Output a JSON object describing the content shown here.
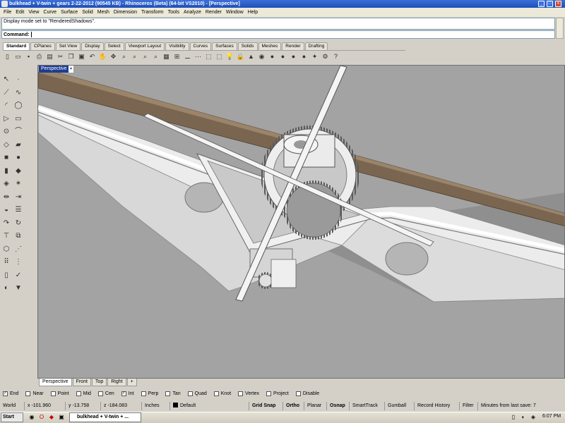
{
  "window": {
    "title": "bulkhead + V-twin + gears 2-22-2012 (90545 KB) - Rhinoceros (Beta) (64-bit VS2010) - [Perspective]",
    "min_label": "_",
    "max_label": "□",
    "close_label": "x"
  },
  "menu": [
    "File",
    "Edit",
    "View",
    "Curve",
    "Surface",
    "Solid",
    "Mesh",
    "Dimension",
    "Transform",
    "Tools",
    "Analyze",
    "Render",
    "Window",
    "Help"
  ],
  "command": {
    "history": "Display mode set to \"RenderedShadows\".",
    "prompt": "Command:"
  },
  "toolbar_tabs": [
    "Standard",
    "CPlanes",
    "Set View",
    "Display",
    "Select",
    "Viewport Layout",
    "Visibility",
    "Curves",
    "Surfaces",
    "Solids",
    "Meshes",
    "Render",
    "Drafting"
  ],
  "toolbar_icons": [
    {
      "name": "new-icon",
      "glyph": "▯"
    },
    {
      "name": "open-icon",
      "glyph": "▭"
    },
    {
      "name": "save-icon",
      "glyph": "▪"
    },
    {
      "name": "print-icon",
      "glyph": "⎙"
    },
    {
      "name": "import-icon",
      "glyph": "▤"
    },
    {
      "name": "cut-icon",
      "glyph": "✂"
    },
    {
      "name": "copy-icon",
      "glyph": "❐"
    },
    {
      "name": "paste-icon",
      "glyph": "▣"
    },
    {
      "name": "undo-icon",
      "glyph": "↶"
    },
    {
      "name": "pan-icon",
      "glyph": "✋"
    },
    {
      "name": "rotate-view-icon",
      "glyph": "✥"
    },
    {
      "name": "zoom-icon",
      "glyph": "⌕"
    },
    {
      "name": "zoom-window-icon",
      "glyph": "⌕"
    },
    {
      "name": "zoom-extents-icon",
      "glyph": "⌕"
    },
    {
      "name": "zoom-selected-icon",
      "glyph": "⌕"
    },
    {
      "name": "cplane-icon",
      "glyph": "▦"
    },
    {
      "name": "four-views-icon",
      "glyph": "⊞"
    },
    {
      "name": "car-icon",
      "glyph": "⚊"
    },
    {
      "name": "points-icon",
      "glyph": "⋯"
    },
    {
      "name": "select-all-icon",
      "glyph": "⬚"
    },
    {
      "name": "properties-icon",
      "glyph": "⬚"
    },
    {
      "name": "lightbulb-icon",
      "glyph": "💡"
    },
    {
      "name": "lock-icon",
      "glyph": "🔒"
    },
    {
      "name": "layer-icon",
      "glyph": "▲"
    },
    {
      "name": "color-wheel-icon",
      "glyph": "◉"
    },
    {
      "name": "render-sphere-icon",
      "glyph": "●"
    },
    {
      "name": "shaded-sphere-icon",
      "glyph": "●"
    },
    {
      "name": "rendered-sphere-icon",
      "glyph": "●"
    },
    {
      "name": "material-sphere-icon",
      "glyph": "●"
    },
    {
      "name": "gumball-icon",
      "glyph": "✦"
    },
    {
      "name": "options-icon",
      "glyph": "⚙"
    },
    {
      "name": "help-icon",
      "glyph": "?"
    }
  ],
  "left_tools": [
    {
      "name": "select-arrow-icon",
      "glyph": "↖"
    },
    {
      "name": "point-icon",
      "glyph": "·"
    },
    {
      "name": "polyline-icon",
      "glyph": "⟋"
    },
    {
      "name": "curve-icon",
      "glyph": "∿"
    },
    {
      "name": "arc-icon",
      "glyph": "◜"
    },
    {
      "name": "circle-icon",
      "glyph": "◯"
    },
    {
      "name": "polygon-icon",
      "glyph": "▷"
    },
    {
      "name": "rectangle-icon",
      "glyph": "▭"
    },
    {
      "name": "ellipse-icon",
      "glyph": "⊙"
    },
    {
      "name": "fillet-curve-icon",
      "glyph": "⌒"
    },
    {
      "name": "surface-icon",
      "glyph": "◇"
    },
    {
      "name": "loft-icon",
      "glyph": "▰"
    },
    {
      "name": "box-icon",
      "glyph": "■"
    },
    {
      "name": "sphere-icon",
      "glyph": "●"
    },
    {
      "name": "cylinder-icon",
      "glyph": "▮"
    },
    {
      "name": "extrude-icon",
      "glyph": "◆"
    },
    {
      "name": "boolean-union-icon",
      "glyph": "◈"
    },
    {
      "name": "fillet-edge-icon",
      "glyph": "✶"
    },
    {
      "name": "mirror-icon",
      "glyph": "⇹"
    },
    {
      "name": "trim-icon",
      "glyph": "⇥"
    },
    {
      "name": "join-icon",
      "glyph": "◒"
    },
    {
      "name": "explode-icon",
      "glyph": "☰"
    },
    {
      "name": "move-icon",
      "glyph": "↷"
    },
    {
      "name": "rotate-icon",
      "glyph": "↻"
    },
    {
      "name": "dimension-icon",
      "glyph": "⊤"
    },
    {
      "name": "text-icon",
      "glyph": "⧉"
    },
    {
      "name": "mesh-icon",
      "glyph": "⬡"
    },
    {
      "name": "analyze-icon",
      "glyph": "⋰"
    },
    {
      "name": "grid-array-icon",
      "glyph": "⠿"
    },
    {
      "name": "array-icon",
      "glyph": "⋮"
    },
    {
      "name": "layout-icon",
      "glyph": "▯"
    },
    {
      "name": "check-icon",
      "glyph": "✓"
    },
    {
      "name": "hide-icon",
      "glyph": "◐"
    },
    {
      "name": "paint-icon",
      "glyph": "▼"
    }
  ],
  "viewport": {
    "label": "Perspective",
    "dropdown": "▾"
  },
  "viewport_tabs": [
    "Perspective",
    "Front",
    "Top",
    "Right",
    "+"
  ],
  "osnaps": [
    {
      "label": "End",
      "checked": true
    },
    {
      "label": "Near",
      "checked": false
    },
    {
      "label": "Point",
      "checked": false
    },
    {
      "label": "Mid",
      "checked": false
    },
    {
      "label": "Cen",
      "checked": false
    },
    {
      "label": "Int",
      "checked": true
    },
    {
      "label": "Perp",
      "checked": false
    },
    {
      "label": "Tan",
      "checked": false
    },
    {
      "label": "Quad",
      "checked": false
    },
    {
      "label": "Knot",
      "checked": false
    },
    {
      "label": "Vertex",
      "checked": false
    },
    {
      "label": "Project",
      "checked": false
    },
    {
      "label": "Disable",
      "checked": false
    }
  ],
  "status": {
    "cplane": "World",
    "x": "x -101.960",
    "y": "y -13.758",
    "z": "z -184.083",
    "units": "Inches",
    "layer": "Default",
    "grid_snap": "Grid Snap",
    "ortho": "Ortho",
    "planar": "Planar",
    "osnap": "Osnap",
    "smarttrack": "SmartTrack",
    "gumball": "Gumball",
    "record_history": "Record History",
    "filter": "Filter",
    "last_save": "Minutes from last save: 7"
  },
  "taskbar": {
    "start": "Start",
    "window": "bulkhead + V-twin + ...",
    "clock": "6:07 PM"
  },
  "colors": {
    "viewport_bg": "#a3a3a3",
    "model_light": "#f2f2f2",
    "model_shadow": "#6e6e6e",
    "beam": "#7a6650",
    "title_bar": "#2458c8"
  }
}
